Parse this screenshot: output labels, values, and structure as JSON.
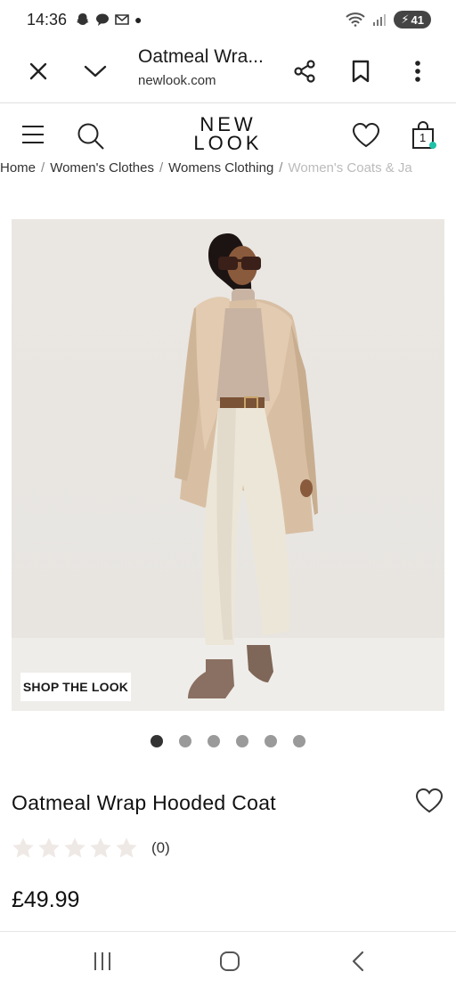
{
  "status_bar": {
    "time": "14:36",
    "battery": "41"
  },
  "browser": {
    "title": "Oatmeal Wra...",
    "url": "newlook.com"
  },
  "header": {
    "logo_line1": "NEW",
    "logo_line2": "LOOK",
    "cart_count": "1"
  },
  "breadcrumb": [
    {
      "label": "Home"
    },
    {
      "label": "Women's Clothes"
    },
    {
      "label": "Womens Clothing"
    },
    {
      "label": "Women's Coats & Ja"
    }
  ],
  "gallery": {
    "shop_look_label": "SHOP THE LOOK",
    "dot_count": 6,
    "active_dot": 0
  },
  "product": {
    "title": "Oatmeal Wrap Hooded Coat",
    "rating_count": "(0)",
    "stars": 0,
    "price": "£49.99"
  },
  "colors": {
    "accent": "#1fc2a8",
    "dot_active": "#333333",
    "dot_inactive": "#9a9a9a"
  }
}
